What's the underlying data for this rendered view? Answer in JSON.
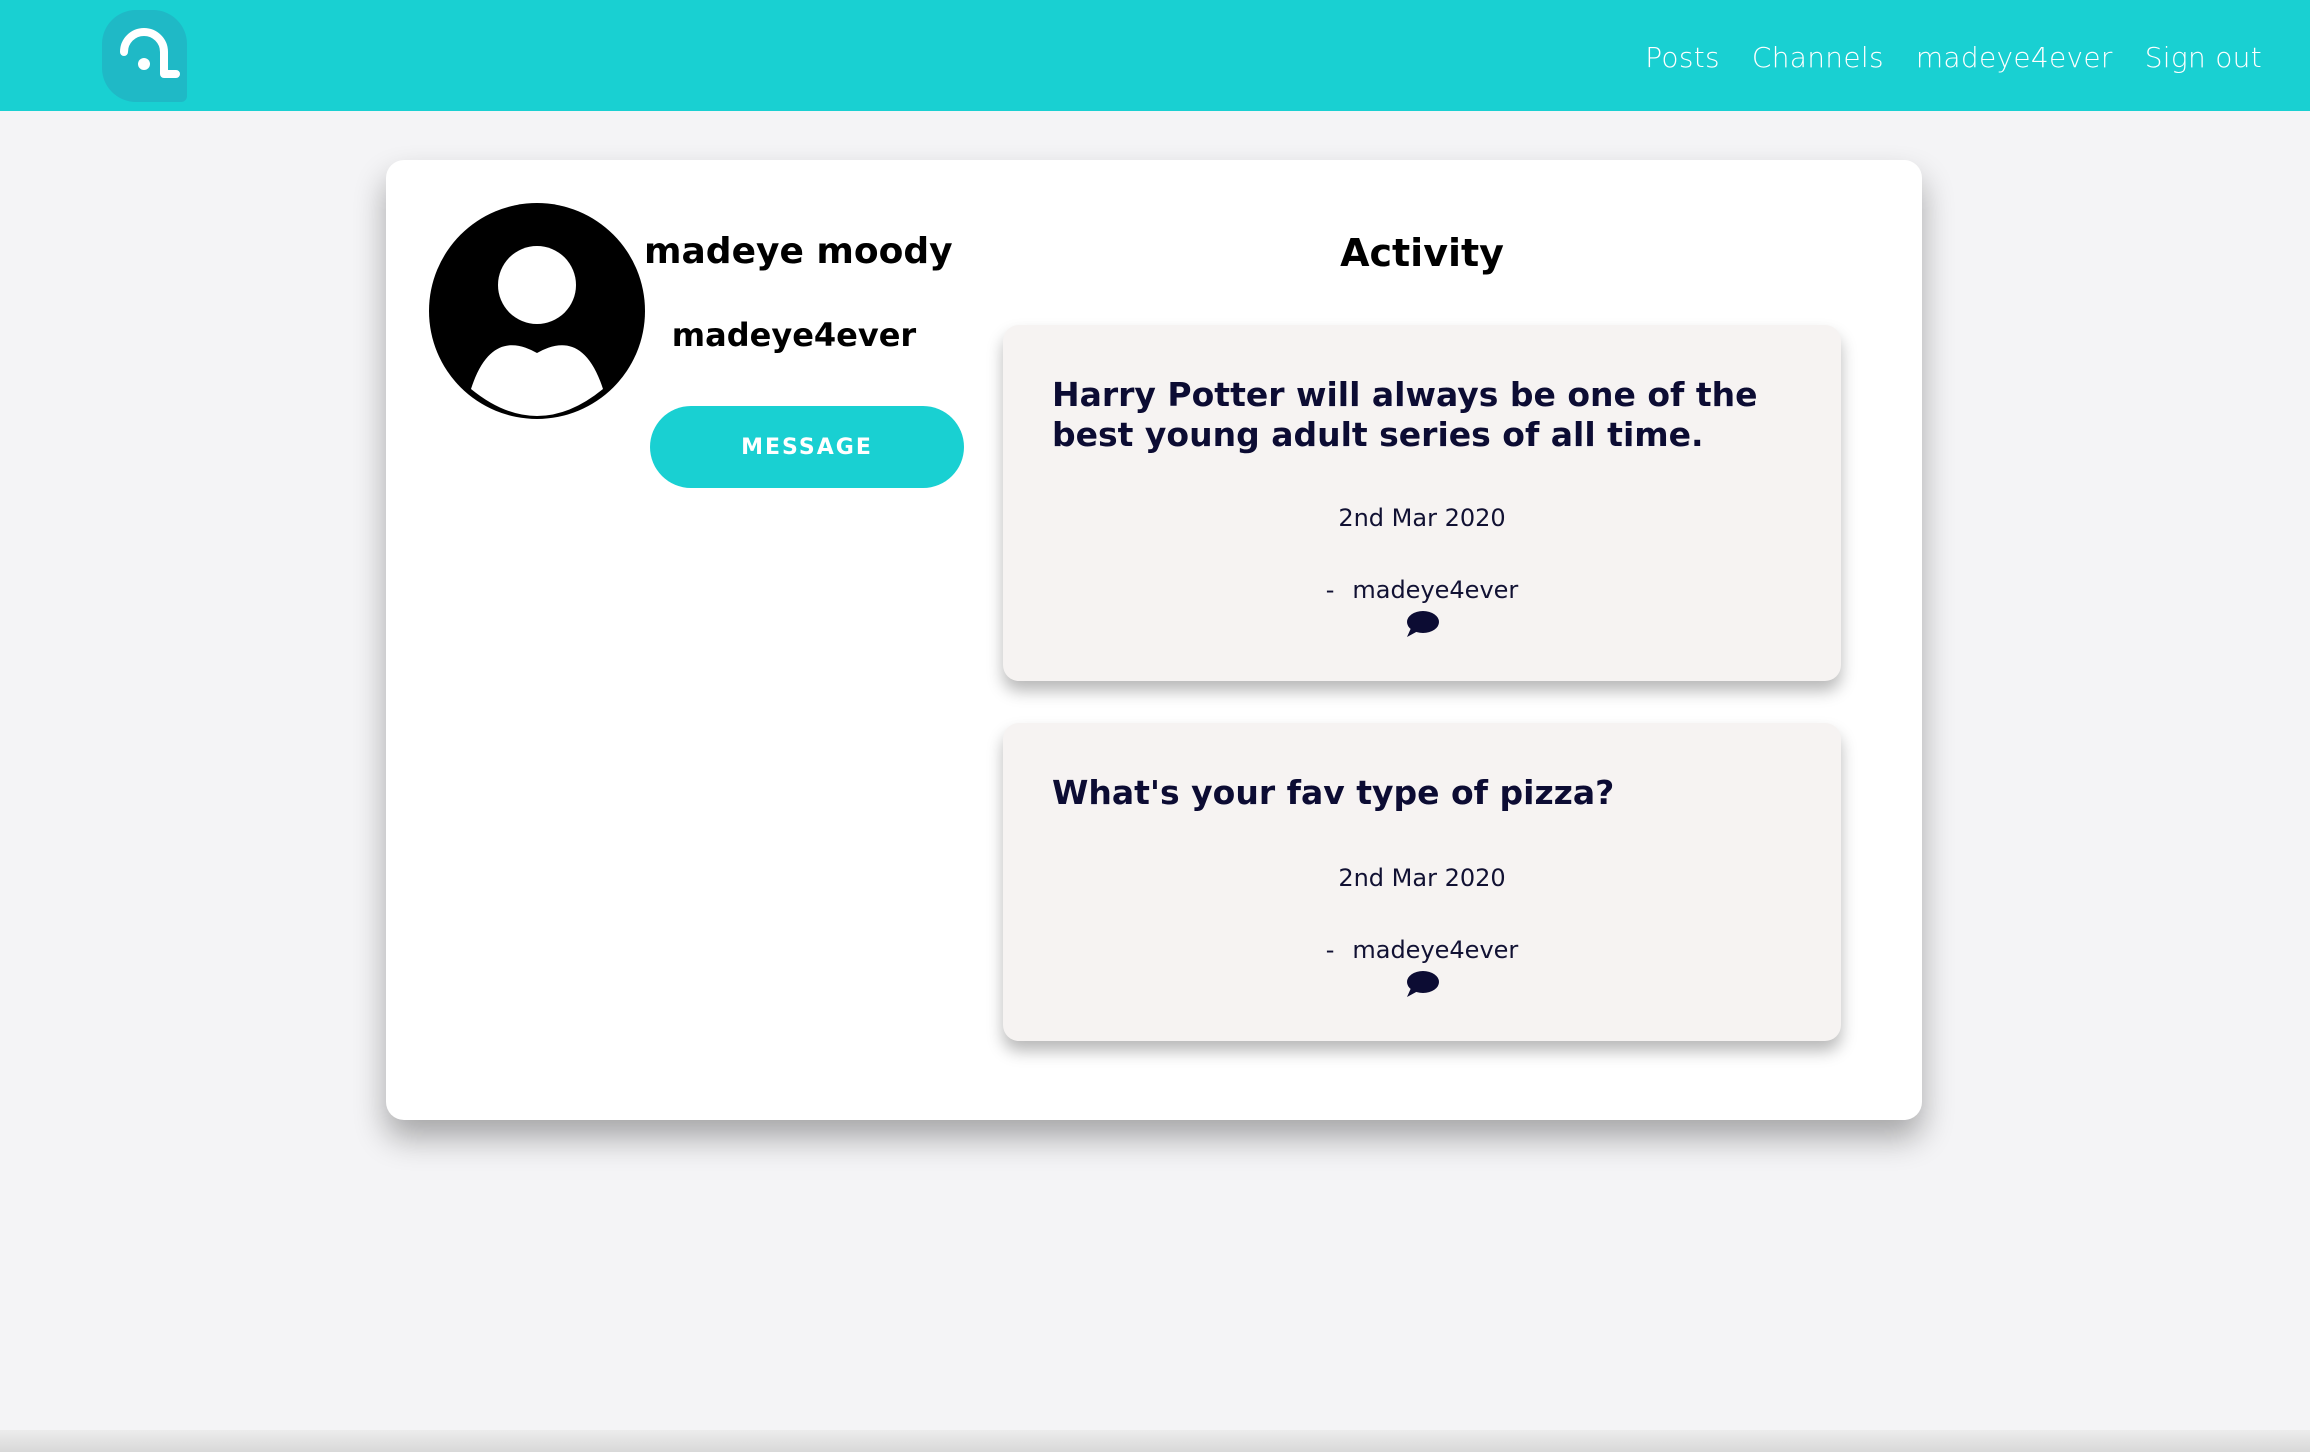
{
  "navbar": {
    "logo": "app-logo",
    "links": [
      {
        "label": "Posts"
      },
      {
        "label": "Channels"
      },
      {
        "label": "madeye4ever"
      },
      {
        "label": "Sign out"
      }
    ],
    "color": "#19d0d2"
  },
  "profile": {
    "full_name": "madeye moody",
    "username": "madeye4ever",
    "message_button_label": "MESSAGE",
    "avatar_icon": "user-avatar-icon"
  },
  "activity": {
    "title": "Activity",
    "posts": [
      {
        "title": "Harry Potter will always be one of the best young adult series of all time.",
        "date": "2nd Mar 2020",
        "author_prefix": "-",
        "author": "madeye4ever",
        "icon": "comment-icon"
      },
      {
        "title": "What's your fav type of pizza?",
        "date": "2nd Mar 2020",
        "author_prefix": "-",
        "author": "madeye4ever",
        "icon": "comment-icon"
      }
    ]
  }
}
